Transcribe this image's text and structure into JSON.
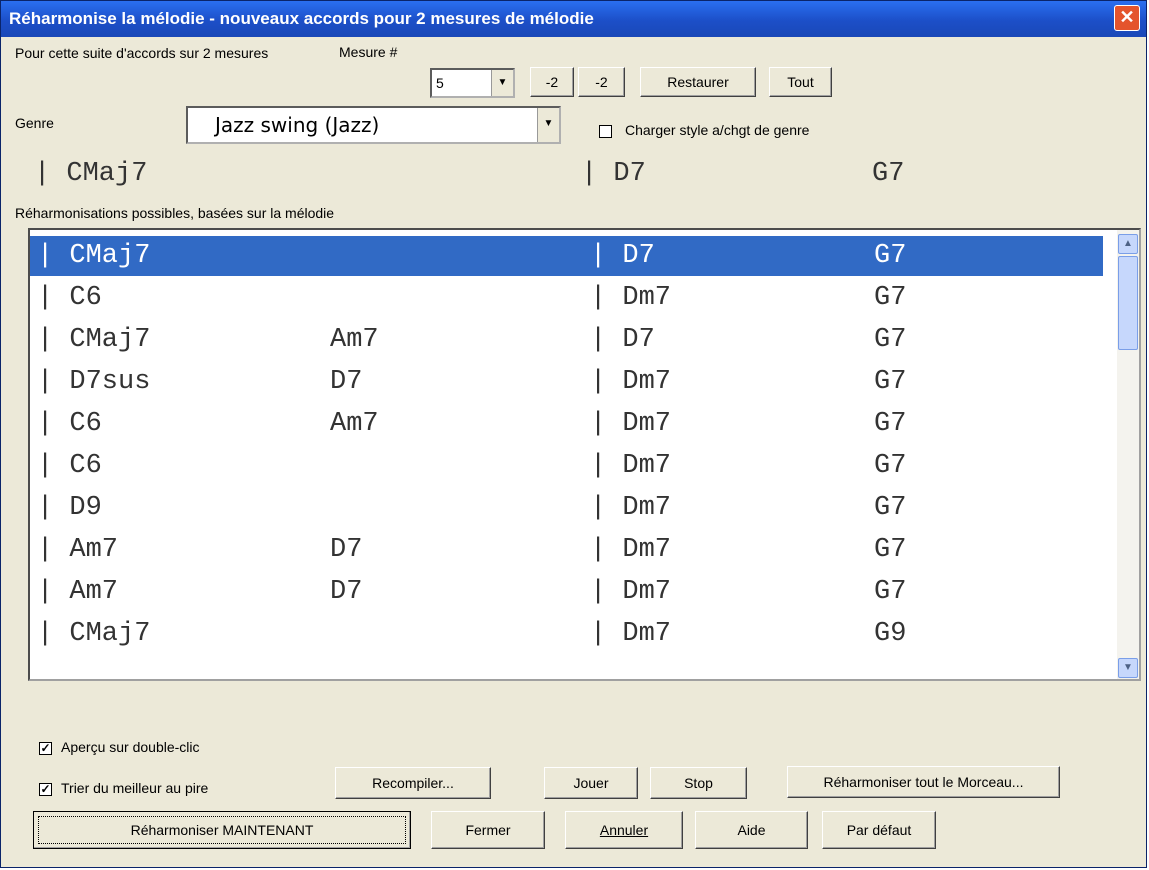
{
  "window": {
    "title": "Réharmonise la mélodie - nouveaux accords pour 2 mesures de mélodie",
    "close_glyph": "✕"
  },
  "header": {
    "suite_label": "Pour cette suite d'accords sur 2 mesures",
    "mesure_label": "Mesure #",
    "mesure_value": "5",
    "btn_minus2_a": "-2",
    "btn_minus2_b": "-2",
    "btn_restaurer": "Restaurer",
    "btn_tout": "Tout",
    "genre_label": "Genre",
    "genre_value": "Jazz  swing (Jazz)",
    "charger_label": "Charger style a/chgt de genre",
    "charger_checked": false
  },
  "current_chords": {
    "bar1": "|  CMaj7",
    "bar2": "|  D7",
    "bar2b": "G7"
  },
  "possible_label": "Réharmonisations possibles, basées sur la mélodie",
  "reharmonizations": [
    {
      "c1": "|  CMaj7",
      "c2": "",
      "c3": "|  D7",
      "c4": "G7",
      "selected": true
    },
    {
      "c1": "|  C6",
      "c2": "",
      "c3": "|  Dm7",
      "c4": "G7",
      "selected": false
    },
    {
      "c1": "|  CMaj7",
      "c2": "Am7",
      "c3": "|  D7",
      "c4": "G7",
      "selected": false
    },
    {
      "c1": "|  D7sus",
      "c2": "D7",
      "c3": "|  Dm7",
      "c4": "G7",
      "selected": false
    },
    {
      "c1": "|  C6",
      "c2": "Am7",
      "c3": "|  Dm7",
      "c4": "G7",
      "selected": false
    },
    {
      "c1": "|  C6",
      "c2": "",
      "c3": "|  Dm7",
      "c4": "G7",
      "selected": false
    },
    {
      "c1": "|  D9",
      "c2": "",
      "c3": "|  Dm7",
      "c4": "G7",
      "selected": false
    },
    {
      "c1": "|  Am7",
      "c2": "D7",
      "c3": "|  Dm7",
      "c4": "G7",
      "selected": false
    },
    {
      "c1": "|  Am7",
      "c2": "D7",
      "c3": "|  Dm7",
      "c4": "G7",
      "selected": false
    },
    {
      "c1": "|  CMaj7",
      "c2": "",
      "c3": "|  Dm7",
      "c4": "G9",
      "selected": false
    }
  ],
  "options": {
    "apercu_label": "Aperçu sur double-clic",
    "apercu_checked": true,
    "trier_label": "Trier du meilleur au pire",
    "trier_checked": true
  },
  "buttons": {
    "recompiler": "Recompiler...",
    "jouer": "Jouer",
    "stop": "Stop",
    "reharm_tout": "Réharmoniser tout le Morceau...",
    "reharm_maintenant": "Réharmoniser MAINTENANT",
    "fermer": "Fermer",
    "annuler": "Annuler",
    "aide": "Aide",
    "par_defaut": "Par défaut"
  }
}
